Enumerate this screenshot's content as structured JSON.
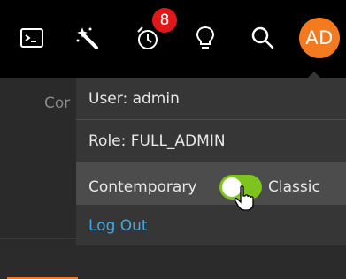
{
  "topbar": {
    "icons": [
      "terminal-icon",
      "magic-wand-icon",
      "alarm-clock-icon",
      "lightbulb-icon",
      "search-icon"
    ],
    "notification_count": "8",
    "avatar_initials": "AD"
  },
  "background": {
    "partial_text": "Cor"
  },
  "user_menu": {
    "user_label": "User: admin",
    "role_label": "Role: FULL_ADMIN",
    "theme_left_label": "Contemporary",
    "theme_right_label": "Classic",
    "logout_label": "Log Out"
  },
  "colors": {
    "accent_orange": "#f47a1f",
    "badge_red": "#e01818",
    "toggle_green": "#7ec41e",
    "link_blue": "#3ea8e6"
  }
}
